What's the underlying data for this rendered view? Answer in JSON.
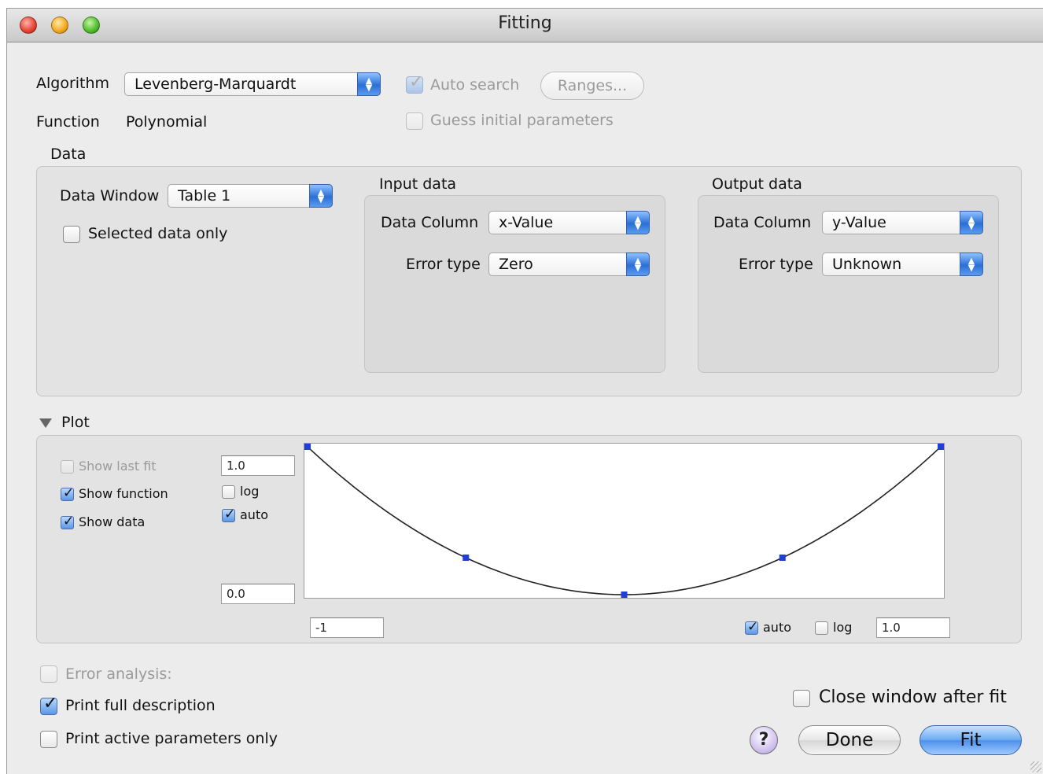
{
  "window": {
    "title": "Fitting"
  },
  "algorithm": {
    "label": "Algorithm",
    "selected": "Levenberg-Marquardt",
    "auto_search_label": "Auto search",
    "auto_search_checked": true,
    "ranges_label": "Ranges...",
    "guess_label": "Guess initial parameters"
  },
  "function": {
    "label": "Function",
    "value": "Polynomial"
  },
  "data": {
    "section_label": "Data",
    "data_window_label": "Data Window",
    "data_window_value": "Table 1",
    "selected_only_label": "Selected data only",
    "input": {
      "title": "Input data",
      "column_label": "Data Column",
      "column_value": "x-Value",
      "error_label": "Error type",
      "error_value": "Zero"
    },
    "output": {
      "title": "Output data",
      "column_label": "Data Column",
      "column_value": "y-Value",
      "error_label": "Error type",
      "error_value": "Unknown"
    }
  },
  "plot": {
    "section_label": "Plot",
    "show_last_fit": "Show last fit",
    "show_function": "Show function",
    "show_data": "Show data",
    "y_max": "1.0",
    "y_min": "0.0",
    "y_log_label": "log",
    "y_auto_label": "auto",
    "x_min": "-1",
    "x_max": "1.0",
    "x_auto_label": "auto",
    "x_log_label": "log"
  },
  "chart_data": {
    "type": "scatter",
    "x": [
      -1,
      -0.5,
      0,
      0.5,
      1
    ],
    "y": [
      1,
      0.25,
      0,
      0.25,
      1
    ],
    "xlim": [
      -1,
      1
    ],
    "ylim": [
      0,
      1
    ],
    "function": "y = x^2",
    "marker_color": "#1f3fd6",
    "curve_color": "#222222"
  },
  "options": {
    "error_analysis": "Error analysis:",
    "print_full": "Print full description",
    "print_active": "Print active parameters only",
    "close_after_fit": "Close window after fit"
  },
  "buttons": {
    "help": "?",
    "done": "Done",
    "fit": "Fit"
  }
}
